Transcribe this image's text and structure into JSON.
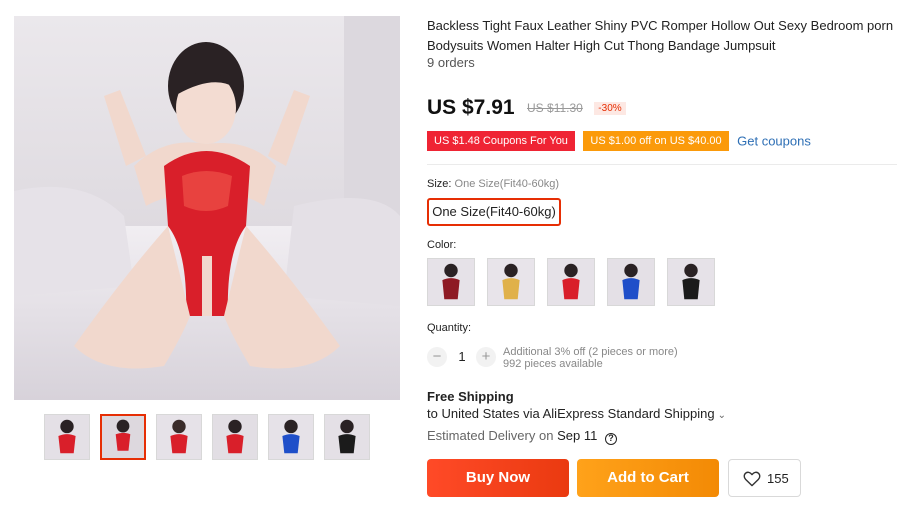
{
  "product": {
    "title": "Backless Tight Faux Leather Shiny PVC Romper Hollow Out Sexy Bedroom porn Bodysuits Women Halter High Cut Thong Bandage Jumpsuit",
    "orders": "9 orders"
  },
  "price": {
    "current": "US $7.91",
    "original": "US $11.30",
    "discount": "-30%"
  },
  "coupons": {
    "items": [
      "US $1.48 Coupons For You",
      "US $1.00 off on US $40.00"
    ],
    "get_label": "Get coupons"
  },
  "size": {
    "label": "Size:",
    "selected": "One Size(Fit40-60kg)",
    "options": [
      "One Size(Fit40-60kg)"
    ]
  },
  "color": {
    "label": "Color:",
    "swatches": [
      "red-black",
      "gold",
      "red",
      "blue",
      "black"
    ]
  },
  "quantity": {
    "label": "Quantity:",
    "value": "1",
    "minus": "−",
    "plus": "+",
    "note": "Additional 3% off (2 pieces or more)",
    "available": "992 pieces available"
  },
  "shipping": {
    "title": "Free Shipping",
    "method": "to United States via AliExpress Standard Shipping",
    "delivery_label": "Estimated Delivery on",
    "delivery_date": "Sep 11"
  },
  "actions": {
    "buy_now": "Buy Now",
    "add_to_cart": "Add to Cart",
    "wishlist_count": "155"
  },
  "gallery": {
    "thumbnail_colors": [
      "red",
      "red",
      "red",
      "red",
      "blue",
      "black"
    ],
    "active_index": 1
  },
  "colors": {
    "accent": "#e62e04",
    "buy": "#ff4a27",
    "cart": "#ffa21a",
    "coupon_red": "#ef2434",
    "coupon_orange": "#fb9a0a",
    "link": "#2e6fb5"
  }
}
